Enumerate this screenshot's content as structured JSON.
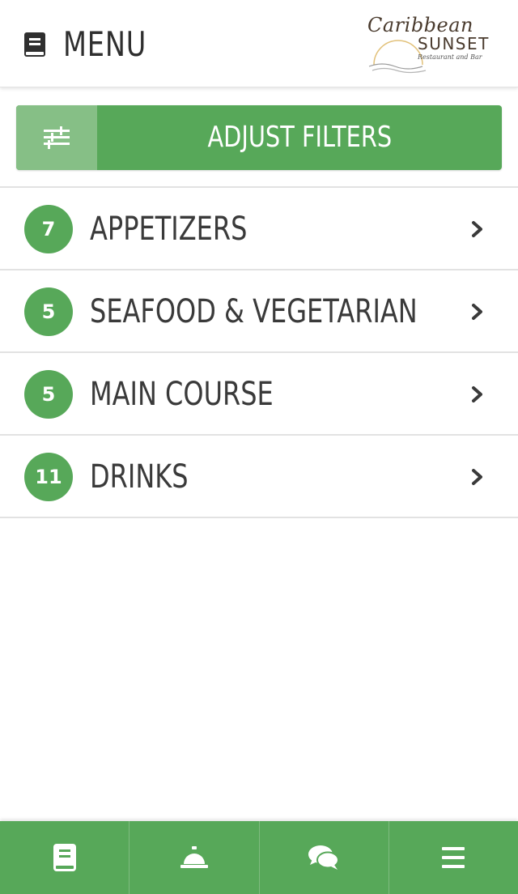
{
  "header": {
    "title": "MENU",
    "menu_icon": "book-icon",
    "logo": {
      "script_text": "Caribbean",
      "main_text": "SUNSET",
      "tagline": "Restaurant and Bar"
    }
  },
  "filter_button": {
    "label": "ADJUST FILTERS",
    "icon": "sliders-icon"
  },
  "categories": [
    {
      "count": "7",
      "label": "APPETIZERS"
    },
    {
      "count": "5",
      "label": "SEAFOOD & VEGETARIAN"
    },
    {
      "count": "5",
      "label": "MAIN COURSE"
    },
    {
      "count": "11",
      "label": "DRINKS"
    }
  ],
  "bottom_nav": [
    {
      "icon": "book-icon"
    },
    {
      "icon": "service-bell-icon"
    },
    {
      "icon": "chat-bubbles-icon"
    },
    {
      "icon": "hamburger-icon"
    }
  ],
  "colors": {
    "accent": "#57a859",
    "accent_light": "#86bf86",
    "text": "#3a3a3a",
    "divider": "#e2e2e2",
    "logo_brown": "#4a3b2e",
    "logo_gold": "#e2c17a"
  }
}
